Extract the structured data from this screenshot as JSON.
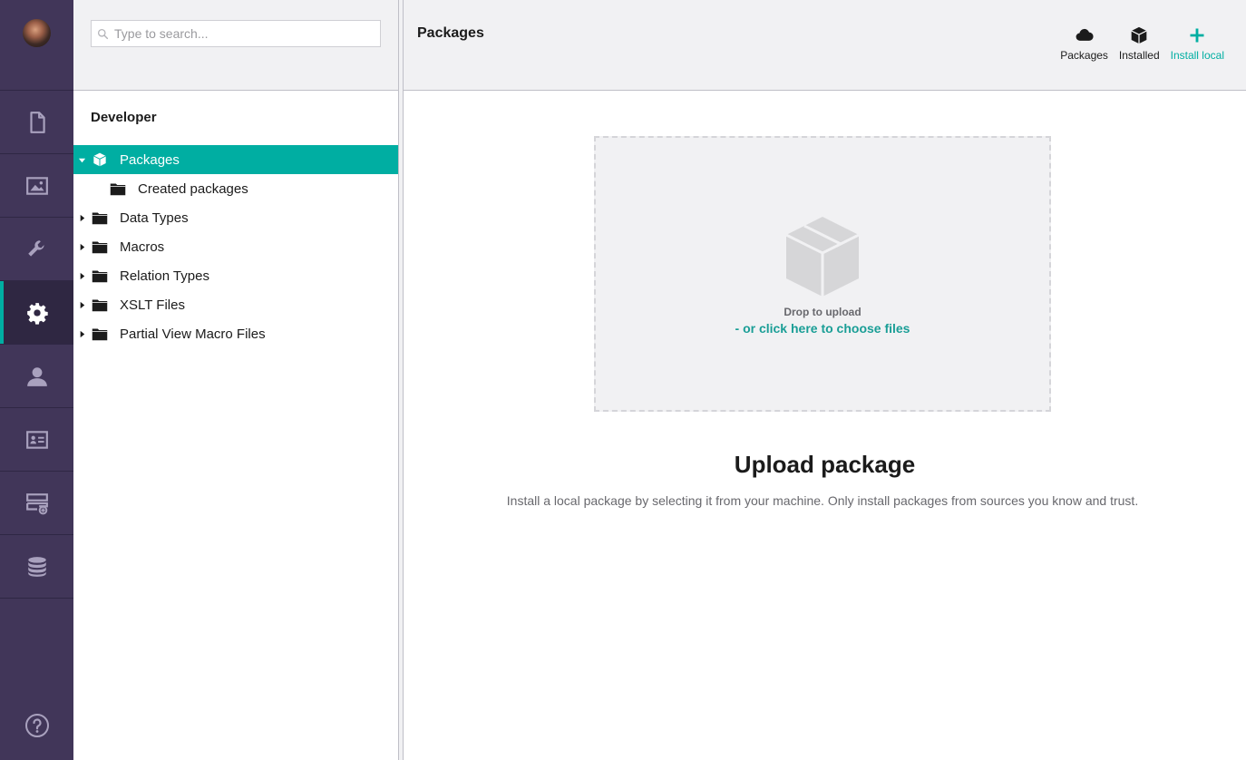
{
  "sections": {
    "items": [
      {
        "icon": "document-icon",
        "active": false
      },
      {
        "icon": "image-icon",
        "active": false
      },
      {
        "icon": "wrench-icon",
        "active": false
      },
      {
        "icon": "gear-icon",
        "active": true
      },
      {
        "icon": "user-icon",
        "active": false
      },
      {
        "icon": "member-card-icon",
        "active": false
      },
      {
        "icon": "forms-icon",
        "active": false
      },
      {
        "icon": "database-icon",
        "active": false
      }
    ],
    "help_icon": "help-icon"
  },
  "tree": {
    "search_placeholder": "Type to search...",
    "root_label": "Developer",
    "nodes": [
      {
        "label": "Packages"
      },
      {
        "label": "Created packages"
      },
      {
        "label": "Data Types"
      },
      {
        "label": "Macros"
      },
      {
        "label": "Relation Types"
      },
      {
        "label": "XSLT Files"
      },
      {
        "label": "Partial View Macro Files"
      }
    ]
  },
  "header": {
    "title": "Packages",
    "tabs": [
      {
        "label": "Packages",
        "icon": "cloud-icon"
      },
      {
        "label": "Installed",
        "icon": "package-icon"
      },
      {
        "label": "Install local",
        "icon": "plus-icon"
      }
    ]
  },
  "upload": {
    "drop_text": "Drop to upload",
    "choose_link": "- or click here to choose files",
    "title": "Upload package",
    "description": "Install a local package by selecting it from your machine. Only install packages from sources you know and trust."
  },
  "colors": {
    "section_bar": "#413659",
    "accent": "#00aea2",
    "panel_bg": "#f1f1f3"
  }
}
